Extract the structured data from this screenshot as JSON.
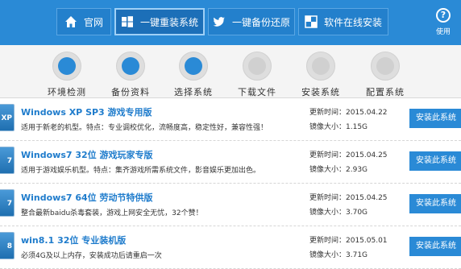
{
  "nav": {
    "items": [
      {
        "label": "官网",
        "icon": "home-icon"
      },
      {
        "label": "一键重装系统",
        "icon": "windows-icon",
        "active": true
      },
      {
        "label": "一键备份还原",
        "icon": "bird-icon"
      },
      {
        "label": "软件在线安装",
        "icon": "apps-icon"
      }
    ],
    "help_label": "使用"
  },
  "steps": [
    {
      "label": "环境检测",
      "done": true
    },
    {
      "label": "备份资料",
      "done": true
    },
    {
      "label": "选择系统",
      "done": true
    },
    {
      "label": "下载文件",
      "done": false
    },
    {
      "label": "安装系统",
      "done": false
    },
    {
      "label": "配置系统",
      "done": false
    }
  ],
  "systems": [
    {
      "icon_text": "XP",
      "title": "Windows XP SP3 游戏专用版",
      "desc": "适用于新老的机型。特点：专业调校优化，流畅度高，稳定性好，兼容性强！",
      "updated": "更新时间：2015.04.22",
      "size": "镜像大小：1.15G",
      "button": "安装此系统"
    },
    {
      "icon_text": "7",
      "title": "Windows7 32位 游戏玩家专版",
      "desc": "适用于游戏娱乐机型。特点：集齐游戏所需系统文件，影音娱乐更加出色。",
      "updated": "更新时间：2015.04.25",
      "size": "镜像大小：2.93G",
      "button": "安装此系统"
    },
    {
      "icon_text": "7",
      "title": "Windows7 64位 劳动节特供版",
      "desc": "整合最新baidu杀毒套装，游戏上网安全无忧，32个赞！",
      "updated": "更新时间：2015.04.25",
      "size": "镜像大小：3.70G",
      "button": "安装此系统"
    },
    {
      "icon_text": "8",
      "title": "win8.1 32位 专业装机版",
      "desc": "必须4G及以上内存，安装成功后请重启一次",
      "updated": "更新时间：2015.05.01",
      "size": "镜像大小：3.71G",
      "button": "安装此系统"
    }
  ],
  "colors": {
    "header": "#2a8ad6",
    "accent": "#1f7ccc",
    "step_done": "#2a8ad6",
    "step_pending": "#d0d0d0"
  }
}
